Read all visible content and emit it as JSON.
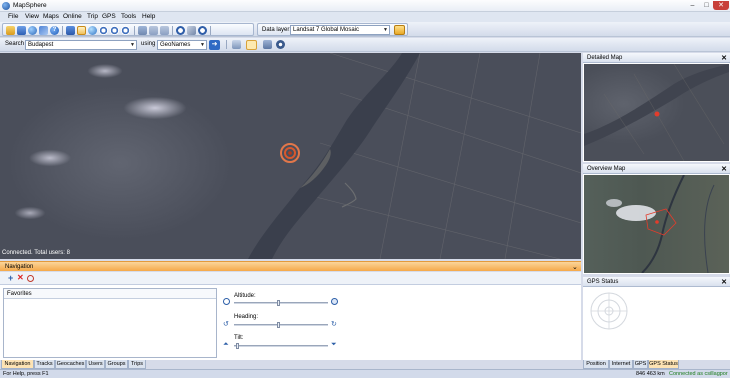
{
  "window": {
    "title": "MapSphere",
    "min": "–",
    "max": "□",
    "close": "✕"
  },
  "menu": [
    "File",
    "View",
    "Maps",
    "Online",
    "Trip",
    "GPS",
    "Tools",
    "Help"
  ],
  "toolbar": {
    "data_layer_label": "Data layer:",
    "data_layer_value": "Landsat 7 Global Mosaic",
    "icons": [
      "open-folder-icon",
      "save-icon",
      "globe-icon",
      "pen-icon",
      "help-icon",
      "layers-icon",
      "map-view-icon",
      "earth-icon",
      "zoom-in-icon",
      "zoom-out-icon",
      "zoom-menu-icon",
      "download-icon",
      "undo-icon",
      "tools-icon",
      "redo-icon",
      "data-layer-settings-icon"
    ]
  },
  "search": {
    "label": "Search",
    "value": "Budapest",
    "using_label": "using",
    "provider": "GeoNames",
    "go_icon": "go-arrow-icon",
    "extra_icons": [
      "find-place-icon",
      "pan-tool-icon",
      "pointer-icon",
      "settings-icon"
    ]
  },
  "map": {
    "status": "Connected.   Total users: 8",
    "marker_icon": "location-target-icon"
  },
  "panes": {
    "detailed_title": "Detailed Map",
    "overview_title": "Overview Map",
    "gps_title": "GPS Status",
    "close": "✕"
  },
  "navigation": {
    "title": "Navigation",
    "collapse": "⌄",
    "tools": [
      "add-icon",
      "delete-icon",
      "route-icon"
    ],
    "favorites_header": "Favorites",
    "altitude_label": "Altitude:",
    "heading_label": "Heading:",
    "tilt_label": "Tilt:"
  },
  "bottom_tabs_left": [
    "Navigation",
    "Tracks",
    "Geocaches",
    "Users",
    "Groups",
    "Trips"
  ],
  "bottom_tabs_right": [
    "Position",
    "Internet",
    "GPS",
    "GPS Status"
  ],
  "statusbar": {
    "help": "For Help, press F1",
    "distance": "846 463 km",
    "connection": "Connected as csillagpor"
  },
  "colors": {
    "accent_orange": "#f5a94a",
    "marker_red": "#e23c2c",
    "connected_green": "#1a7a1a"
  }
}
